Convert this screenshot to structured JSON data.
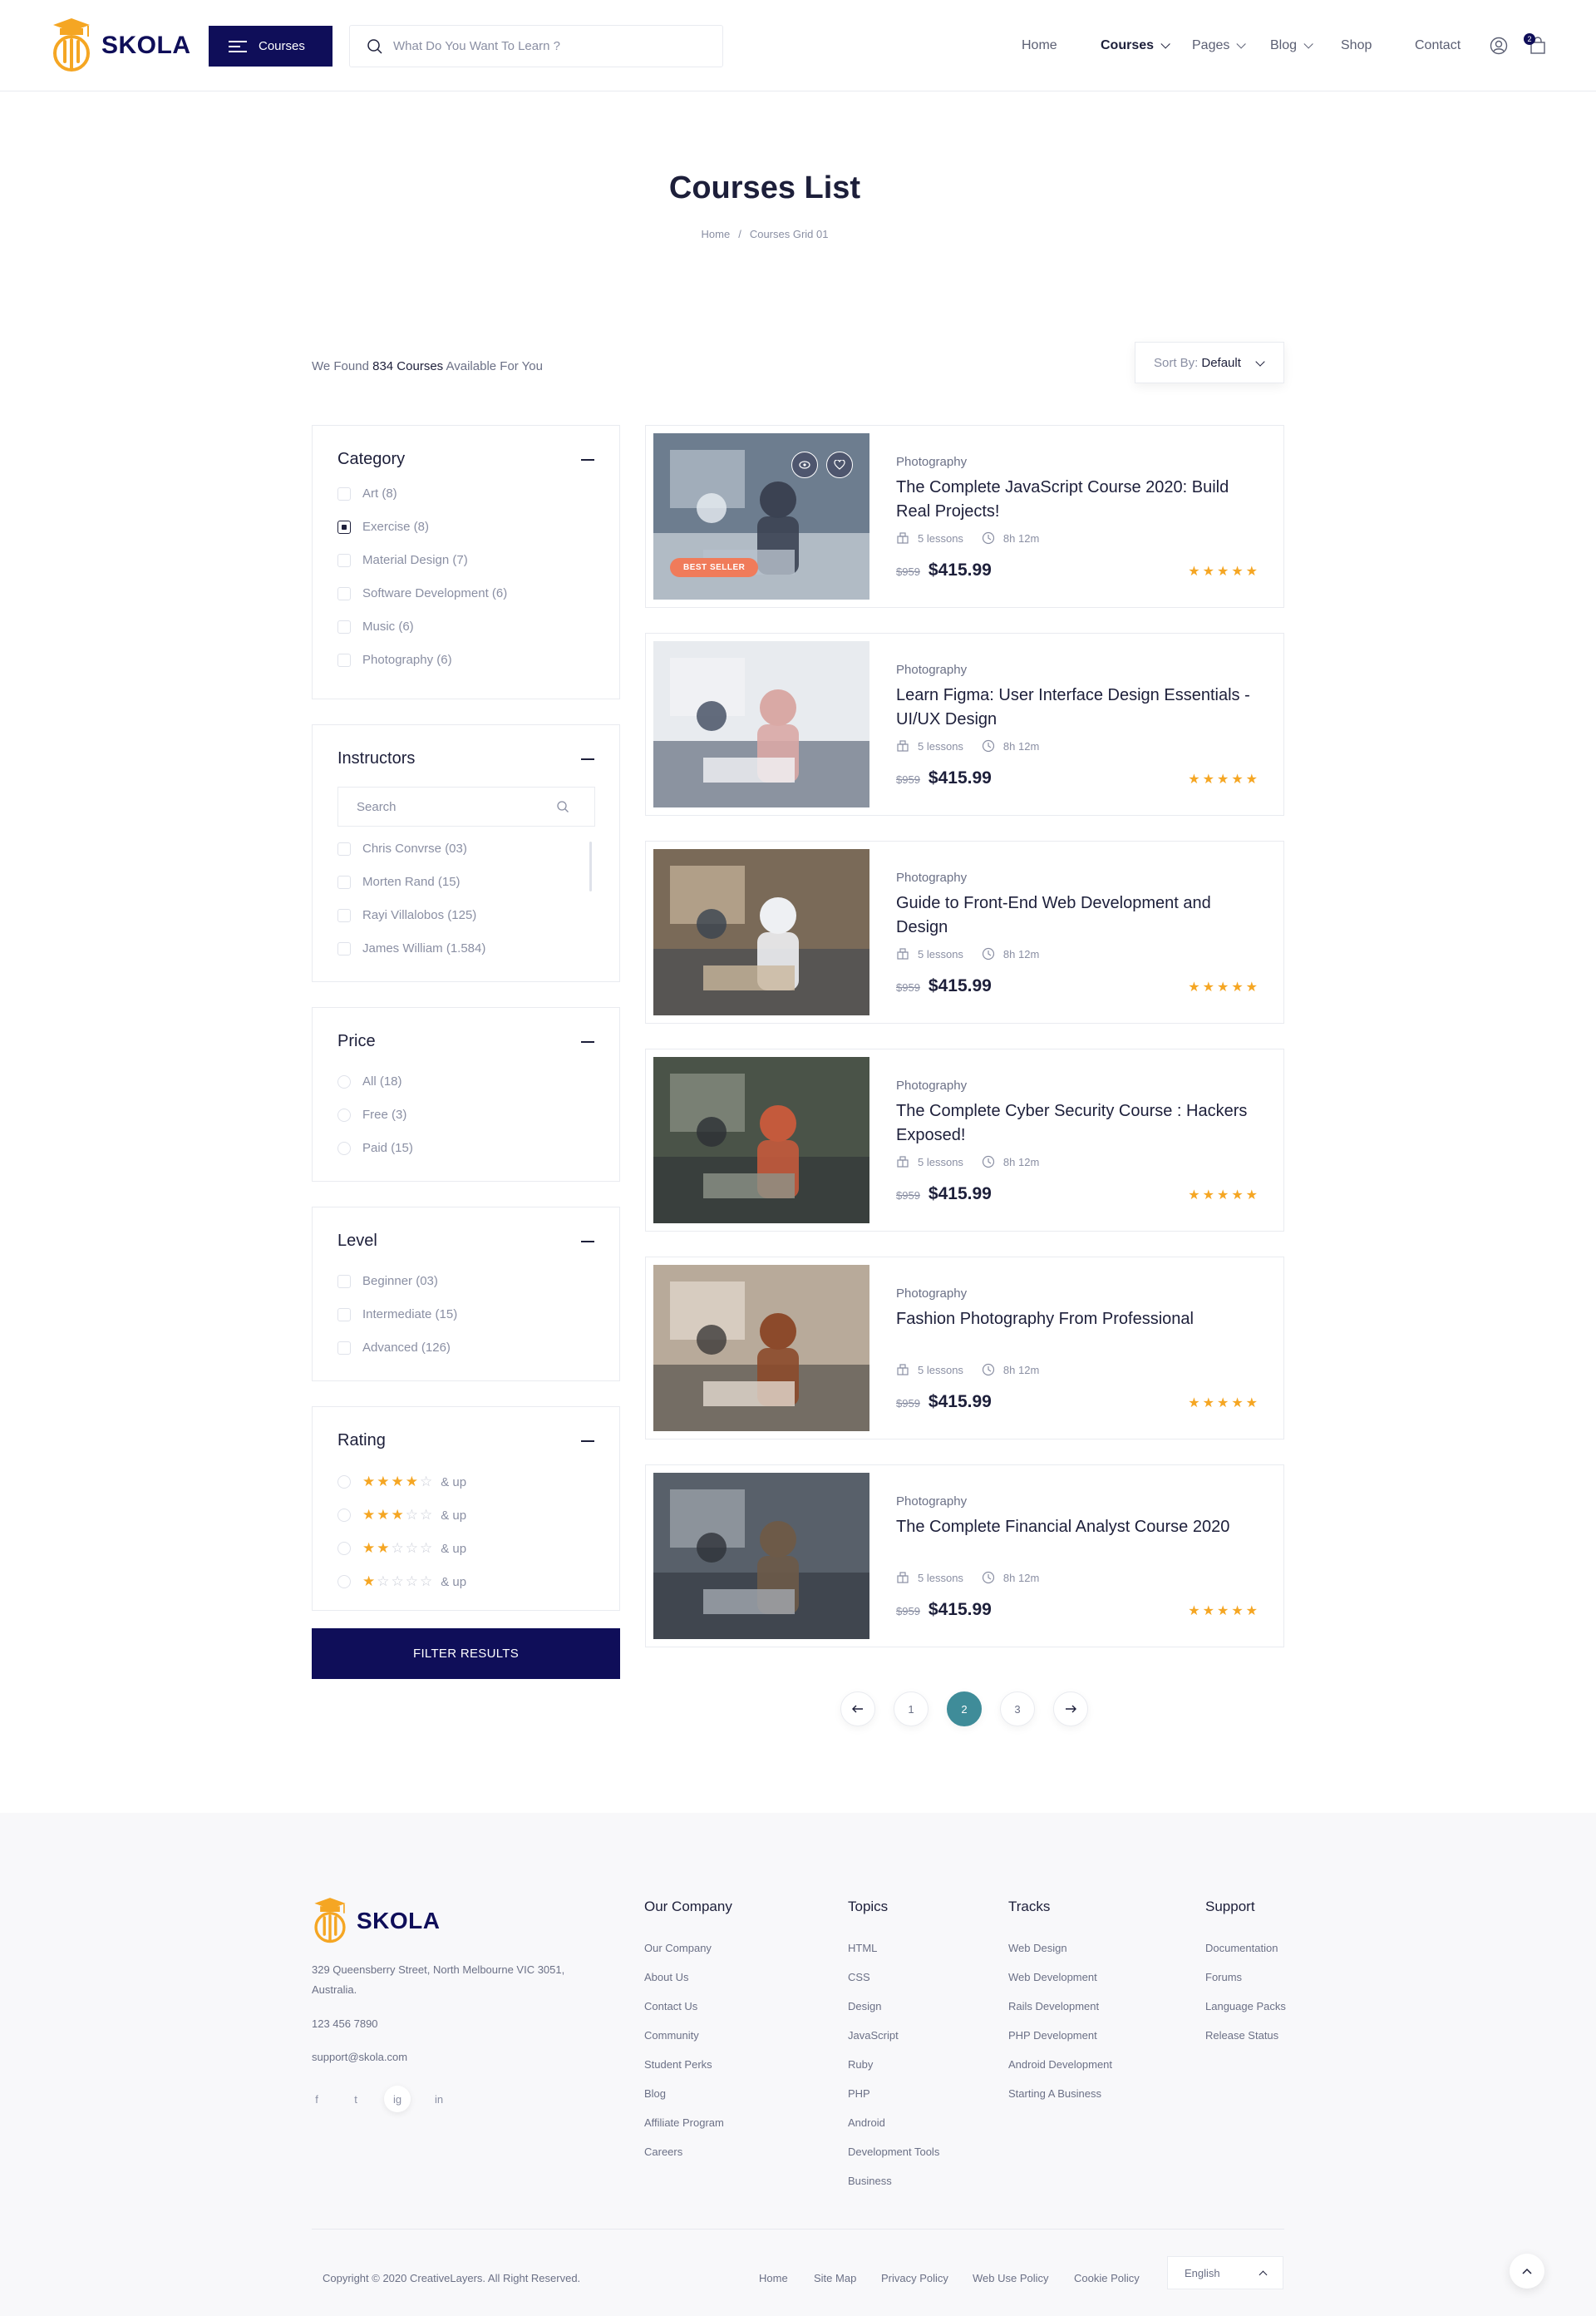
{
  "brand": {
    "name": "SKOLA",
    "colors": {
      "navy": "#0f0e59",
      "orange": "#f5a623",
      "teal": "#3f8c99"
    }
  },
  "header": {
    "courses_button": "Courses",
    "search_placeholder": "What Do You Want To Learn ?",
    "nav": [
      "Home",
      "Courses",
      "Pages",
      "Blog",
      "Shop",
      "Contact"
    ],
    "cart_count": "2"
  },
  "page": {
    "title": "Courses List",
    "breadcrumb": [
      "Home",
      "/",
      "Courses Grid 01"
    ],
    "found_prefix": "We Found",
    "found_count": "834 Courses",
    "found_suffix": "Available For You",
    "sort_label": "Sort By:",
    "sort_value": "Default"
  },
  "filters": {
    "category": {
      "title": "Category",
      "options": [
        "Art (8)",
        "Exercise (8)",
        "Material Design (7)",
        "Software Development (6)",
        "Music (6)",
        "Photography (6)"
      ],
      "checked": "Exercise (8)"
    },
    "instructors": {
      "title": "Instructors",
      "search_placeholder": "Search",
      "options": [
        "Chris Convrse (03)",
        "Morten Rand (15)",
        "Rayi Villalobos (125)",
        "James William (1.584)"
      ]
    },
    "price": {
      "title": "Price",
      "options": [
        "All (18)",
        "Free (3)",
        "Paid (15)"
      ]
    },
    "level": {
      "title": "Level",
      "options": [
        "Beginner (03)",
        "Intermediate (15)",
        "Advanced (126)"
      ]
    },
    "rating": {
      "title": "Rating",
      "suffix": "& up",
      "levels": [
        4,
        3,
        2,
        1
      ]
    },
    "button": "FILTER RESULTS"
  },
  "courses": [
    {
      "category": "Photography",
      "title": "The Complete JavaScript Course 2020: Build Real Projects!",
      "lessons": "5 lessons",
      "duration": "8h 12m",
      "old_price": "$959",
      "price": "$415.99",
      "badge": "BEST SELLER",
      "rating": 5
    },
    {
      "category": "Photography",
      "title": "Learn Figma: User Interface Design Essentials - UI/UX Design",
      "lessons": "5 lessons",
      "duration": "8h 12m",
      "old_price": "$959",
      "price": "$415.99",
      "rating": 5
    },
    {
      "category": "Photography",
      "title": "Guide to Front-End Web Development and Design",
      "lessons": "5 lessons",
      "duration": "8h 12m",
      "old_price": "$959",
      "price": "$415.99",
      "rating": 5
    },
    {
      "category": "Photography",
      "title": "The Complete Cyber Security Course : Hackers Exposed!",
      "lessons": "5 lessons",
      "duration": "8h 12m",
      "old_price": "$959",
      "price": "$415.99",
      "rating": 5
    },
    {
      "category": "Photography",
      "title": "Fashion Photography From Professional",
      "lessons": "5 lessons",
      "duration": "8h 12m",
      "old_price": "$959",
      "price": "$415.99",
      "rating": 5
    },
    {
      "category": "Photography",
      "title": "The Complete Financial Analyst Course 2020",
      "lessons": "5 lessons",
      "duration": "8h 12m",
      "old_price": "$959",
      "price": "$415.99",
      "rating": 5
    }
  ],
  "pagination": {
    "pages": [
      "1",
      "2",
      "3"
    ],
    "current": "2",
    "prev_icon": "arrow-left-icon",
    "next_icon": "arrow-right-icon"
  },
  "footer": {
    "address": "329 Queensberry Street, North Melbourne VIC 3051, Australia.",
    "phone": "123 456 7890",
    "email": "support@skola.com",
    "social": [
      "f",
      "t",
      "ig",
      "in"
    ],
    "columns": [
      {
        "title": "Our Company",
        "links": [
          "Our Company",
          "About Us",
          "Contact Us",
          "Community",
          "Student Perks",
          "Blog",
          "Affiliate Program",
          "Careers"
        ]
      },
      {
        "title": "Topics",
        "links": [
          "HTML",
          "CSS",
          "Design",
          "JavaScript",
          "Ruby",
          "PHP",
          "Android",
          "Development Tools",
          "Business"
        ]
      },
      {
        "title": "Tracks",
        "links": [
          "Web Design",
          "Web Development",
          "Rails Development",
          "PHP Development",
          "Android Development",
          "Starting A Business"
        ]
      },
      {
        "title": "Support",
        "links": [
          "Documentation",
          "Forums",
          "Language Packs",
          "Release Status"
        ]
      }
    ],
    "copyright": "Copyright © 2020 CreativeLayers. All Right Reserved.",
    "bottom_links": [
      "Home",
      "Site Map",
      "Privacy Policy",
      "Web Use Policy",
      "Cookie Policy"
    ],
    "language": "English"
  }
}
